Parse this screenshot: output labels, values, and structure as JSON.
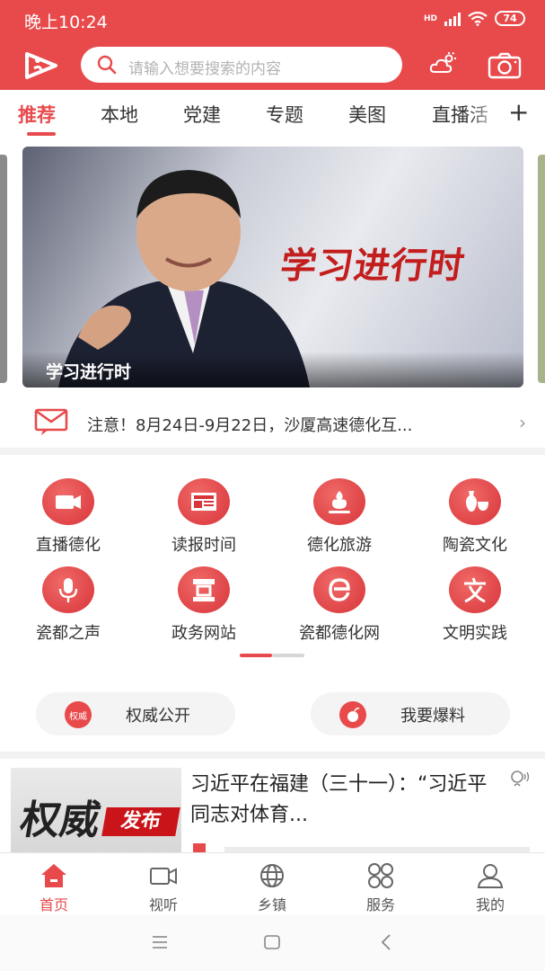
{
  "status_bar": {
    "time": "晚上10:24",
    "network": "HD",
    "battery": "74"
  },
  "search": {
    "placeholder": "请输入想要搜索的内容"
  },
  "tabs": [
    {
      "label": "推荐",
      "active": true
    },
    {
      "label": "本地"
    },
    {
      "label": "党建"
    },
    {
      "label": "专题"
    },
    {
      "label": "美图"
    },
    {
      "label": "直播活"
    }
  ],
  "banner": {
    "slogan": "学习进行时",
    "caption": "学习进行时"
  },
  "notice": {
    "text": "注意！8月24日-9月22日，沙厦高速德化互..."
  },
  "services": [
    {
      "label": "直播德化",
      "icon": "video-camera-icon"
    },
    {
      "label": "读报时间",
      "icon": "newspaper-icon"
    },
    {
      "label": "德化旅游",
      "icon": "tourism-icon"
    },
    {
      "label": "陶瓷文化",
      "icon": "ceramics-icon"
    },
    {
      "label": "瓷都之声",
      "icon": "microphone-icon"
    },
    {
      "label": "政务网站",
      "icon": "government-icon"
    },
    {
      "label": "瓷都德化网",
      "icon": "website-icon"
    },
    {
      "label": "文明实践",
      "icon": "civilization-icon"
    }
  ],
  "pills": [
    {
      "label": "权威公开",
      "icon_text": "权威"
    },
    {
      "label": "我要爆料",
      "icon_text": ""
    }
  ],
  "news": [
    {
      "title": "习近平在福建（三十一）：“习近平同志对体育...",
      "thumb_main": "权威",
      "thumb_badge": "发布"
    }
  ],
  "bottom_nav": [
    {
      "label": "首页",
      "active": true
    },
    {
      "label": "视听"
    },
    {
      "label": "乡镇"
    },
    {
      "label": "服务"
    },
    {
      "label": "我的"
    }
  ],
  "colors": {
    "brand": "#e84a4c",
    "text": "#222222",
    "muted": "#b3b3b3"
  }
}
